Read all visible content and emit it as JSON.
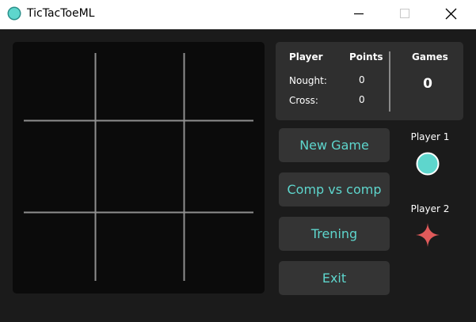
{
  "window": {
    "title": "TicTacToeML",
    "icon": "circle-logo-icon",
    "controls": [
      "minimize-icon",
      "maximize-icon",
      "close-icon"
    ]
  },
  "board": {
    "cells": [
      [
        "",
        "",
        ""
      ],
      [
        "",
        "",
        ""
      ],
      [
        "",
        "",
        ""
      ]
    ]
  },
  "scoreboard": {
    "player_header": "Player",
    "points_header": "Points",
    "games_header": "Games",
    "rows": [
      {
        "player": "Nought:",
        "points": "0"
      },
      {
        "player": "Cross:",
        "points": "0"
      }
    ],
    "games_value": "0"
  },
  "menu": {
    "new_game": "New Game",
    "comp_vs_comp": "Comp vs comp",
    "training": "Trening",
    "exit": "Exit"
  },
  "players": {
    "player1": {
      "label": "Player 1",
      "icon": "nought-circle-icon"
    },
    "player2": {
      "label": "Player 2",
      "icon": "cross-star-icon"
    }
  },
  "colors": {
    "accent_teal": "#5ed6cd",
    "cross_red": "#e05a5a",
    "background": "#1b1b1b",
    "board": "#0b0b0b",
    "panel": "#2f2f2f",
    "button": "#343434",
    "grid_line": "#8f8f8f"
  }
}
